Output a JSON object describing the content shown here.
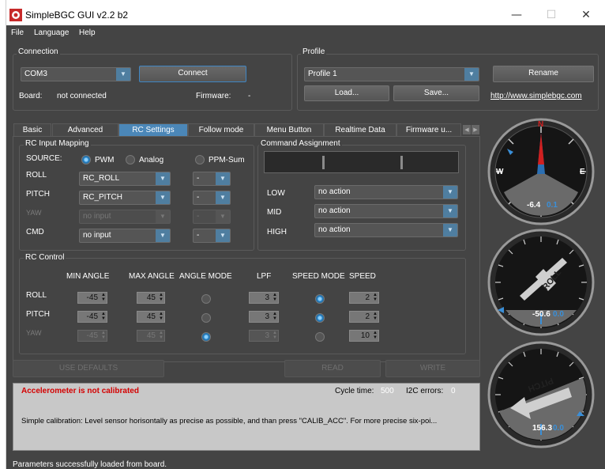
{
  "window": {
    "title": "SimpleBGC GUI v2.2 b2"
  },
  "menu": [
    "File",
    "Language",
    "Help"
  ],
  "connection": {
    "section": "Connection",
    "port": "COM3",
    "connect_label": "Connect",
    "board_label": "Board:",
    "board_value": "not connected",
    "firmware_label": "Firmware:",
    "firmware_value": "-"
  },
  "profile": {
    "section": "Profile",
    "selected": "Profile 1",
    "load_label": "Load...",
    "save_label": "Save...",
    "rename_label": "Rename",
    "link": "http://www.simplebgc.com"
  },
  "tabs": [
    "Basic",
    "Advanced",
    "RC Settings",
    "Follow mode",
    "Menu Button",
    "Realtime Data",
    "Firmware u..."
  ],
  "rc_input": {
    "section": "RC Input Mapping",
    "source_label": "SOURCE:",
    "source_options": [
      "PWM",
      "Analog",
      "PPM-Sum"
    ],
    "rows": [
      {
        "label": "ROLL",
        "value": "RC_ROLL",
        "sub": "-"
      },
      {
        "label": "PITCH",
        "value": "RC_PITCH",
        "sub": "-"
      },
      {
        "label": "YAW",
        "value": "no input",
        "sub": "-"
      },
      {
        "label": "CMD",
        "value": "no input",
        "sub": "-"
      }
    ]
  },
  "command": {
    "section": "Command Assignment",
    "rows": [
      {
        "label": "LOW",
        "value": "no action"
      },
      {
        "label": "MID",
        "value": "no action"
      },
      {
        "label": "HIGH",
        "value": "no action"
      }
    ]
  },
  "rc_control": {
    "section": "RC Control",
    "headers": [
      "MIN ANGLE",
      "MAX ANGLE",
      "ANGLE MODE",
      "LPF",
      "SPEED MODE",
      "SPEED"
    ],
    "rows": [
      {
        "label": "ROLL",
        "min": "-45",
        "max": "45",
        "lpf": "3",
        "speed": "2"
      },
      {
        "label": "PITCH",
        "min": "-45",
        "max": "45",
        "lpf": "3",
        "speed": "2"
      },
      {
        "label": "YAW",
        "min": "-45",
        "max": "45",
        "lpf": "3",
        "speed": "10"
      }
    ]
  },
  "actions": {
    "defaults": "USE DEFAULTS",
    "read": "READ",
    "write": "WRITE"
  },
  "log": {
    "warning": "Accelerometer is not calibrated",
    "cycle_label": "Cycle time:",
    "cycle_value": "500",
    "i2c_label": "I2C errors:",
    "i2c_value": "0",
    "message": "Simple calibration: Level sensor horisontally as precise as possible, and than press \"CALIB_ACC\". For more precise six-poi..."
  },
  "status": "Parameters successfully loaded from board.",
  "gauges": {
    "yaw": {
      "n": "N",
      "w": "W",
      "e": "E",
      "value": "-6.4",
      "rc": "0.1"
    },
    "roll": {
      "label": "ROLL",
      "value": "-50.6",
      "rc": "0.0"
    },
    "pitch": {
      "label": "PITCH",
      "value": "156.3",
      "rc": "0.0"
    }
  },
  "colors": {
    "accent": "#4b87b8",
    "warning": "#d40000",
    "background": "#444444"
  }
}
